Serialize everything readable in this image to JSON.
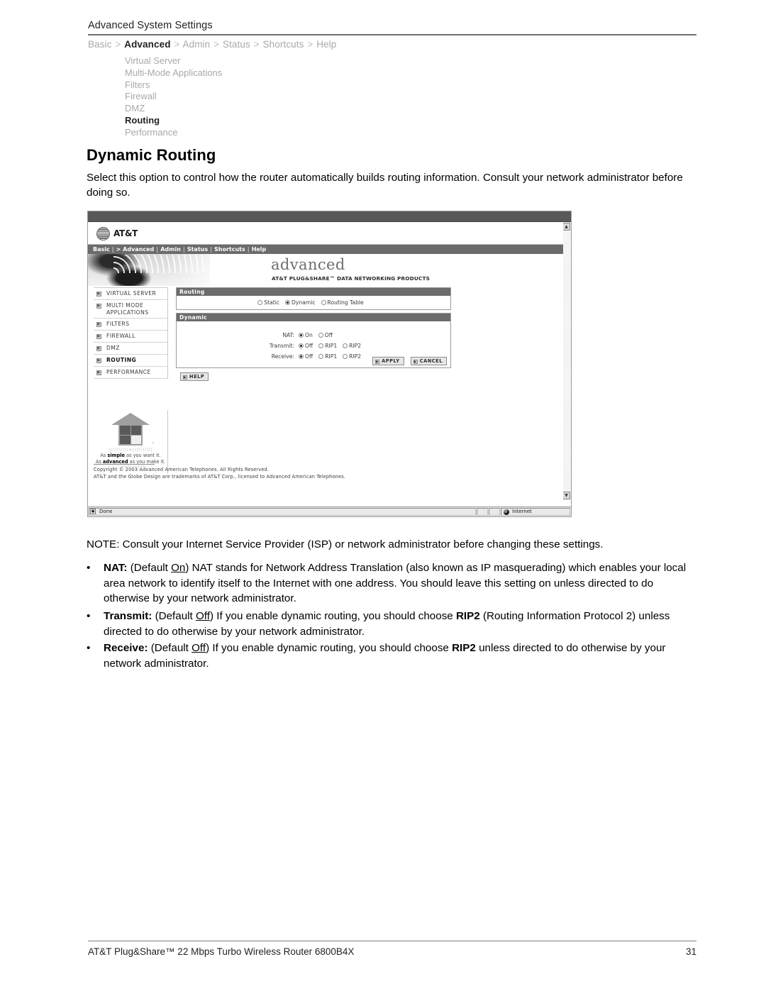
{
  "running_head": "Advanced System Settings",
  "breadcrumb": {
    "items": [
      "Basic",
      "Advanced",
      "Admin",
      "Status",
      "Shortcuts",
      "Help"
    ],
    "current": "Advanced",
    "separator": ">"
  },
  "subnav": {
    "items": [
      {
        "label": "Virtual Server",
        "active": false
      },
      {
        "label": "Multi-Mode Applications",
        "active": false
      },
      {
        "label": "Filters",
        "active": false
      },
      {
        "label": "Firewall",
        "active": false
      },
      {
        "label": "DMZ",
        "active": false
      },
      {
        "label": "Routing",
        "active": true
      },
      {
        "label": "Performance",
        "active": false
      }
    ]
  },
  "page_title": "Dynamic Routing",
  "intro": "Select this option to control how the router automatically builds routing information. Consult your network administrator before doing so.",
  "screenshot": {
    "brand": "AT&T",
    "nav": [
      "Basic",
      "> Advanced",
      "Admin",
      "Status",
      "Shortcuts",
      "Help"
    ],
    "banner_word": "advanced",
    "banner_sub": "AT&T PLUG&SHARE™ DATA NETWORKING PRODUCTS",
    "sidebar": [
      {
        "label": "VIRTUAL SERVER",
        "active": false
      },
      {
        "label": "MULTI MODE APPLICATIONS",
        "active": false
      },
      {
        "label": "FILTERS",
        "active": false
      },
      {
        "label": "FIREWALL",
        "active": false
      },
      {
        "label": "DMZ",
        "active": false
      },
      {
        "label": "ROUTING",
        "active": true
      },
      {
        "label": "PERFORMANCE",
        "active": false
      }
    ],
    "promo": {
      "arcs": "((((((((((∗))))))))))",
      "line1_pre": "As ",
      "line1_bold": "simple",
      "line1_post": " as you want it.",
      "line2_pre": "As ",
      "line2_bold": "advanced",
      "line2_post": " as you make it.",
      "dots": "·········•••••••••·····"
    },
    "panel_routing": {
      "title": "Routing",
      "options": [
        {
          "label": "Static",
          "selected": false
        },
        {
          "label": "Dynamic",
          "selected": true
        },
        {
          "label": "Routing Table",
          "selected": false
        }
      ]
    },
    "panel_dynamic": {
      "title": "Dynamic",
      "rows": [
        {
          "label": "NAT:",
          "options": [
            {
              "label": "On",
              "selected": true
            },
            {
              "label": "Off",
              "selected": false
            }
          ]
        },
        {
          "label": "Transmit:",
          "options": [
            {
              "label": "Off",
              "selected": true
            },
            {
              "label": "RIP1",
              "selected": false
            },
            {
              "label": "RIP2",
              "selected": false
            }
          ]
        },
        {
          "label": "Receive:",
          "options": [
            {
              "label": "Off",
              "selected": true
            },
            {
              "label": "RIP1",
              "selected": false
            },
            {
              "label": "RIP2",
              "selected": false
            }
          ]
        }
      ],
      "apply_label": "APPLY",
      "cancel_label": "CANCEL"
    },
    "help_label": "HELP",
    "copyright_line1": "Copyright © 2003 Advanced American Telephones. All Rights Reserved.",
    "copyright_line2": "AT&T and the Globe Design are trademarks of AT&T Corp., licensed to Advanced American Telephones.",
    "status_text": "Done",
    "status_zone": "Internet"
  },
  "note": "NOTE: Consult your Internet Service Provider (ISP) or network administrator before changing these settings.",
  "bullets": [
    {
      "bullet": "•",
      "term": "NAT:",
      "default_pre": " (Default ",
      "default_val": "On",
      "default_post": ") ",
      "text": "NAT stands for Network Address Translation (also known as IP masquerading) which enables your local area network to identify itself to the Internet with one address. You should leave this setting on unless directed to do otherwise by your network administrator."
    },
    {
      "bullet": "•",
      "term": "Transmit:",
      "default_pre": " (Default ",
      "default_val": "Off",
      "default_post": ") ",
      "text_pre": "If you enable dynamic routing, you should choose ",
      "emph": "RIP2",
      "text_post": " (Routing Information Protocol 2) unless directed to do otherwise by your network administrator."
    },
    {
      "bullet": "•",
      "term": "Receive:",
      "default_pre": " (Default ",
      "default_val": "Off",
      "default_post": ") ",
      "text_pre": "If you enable dynamic routing, you should choose ",
      "emph": "RIP2",
      "text_post": " unless directed to do otherwise by your network administrator."
    }
  ],
  "footer": {
    "left": "AT&T Plug&Share™ 22 Mbps Turbo Wireless Router 6800B4X",
    "page_number": "31"
  }
}
